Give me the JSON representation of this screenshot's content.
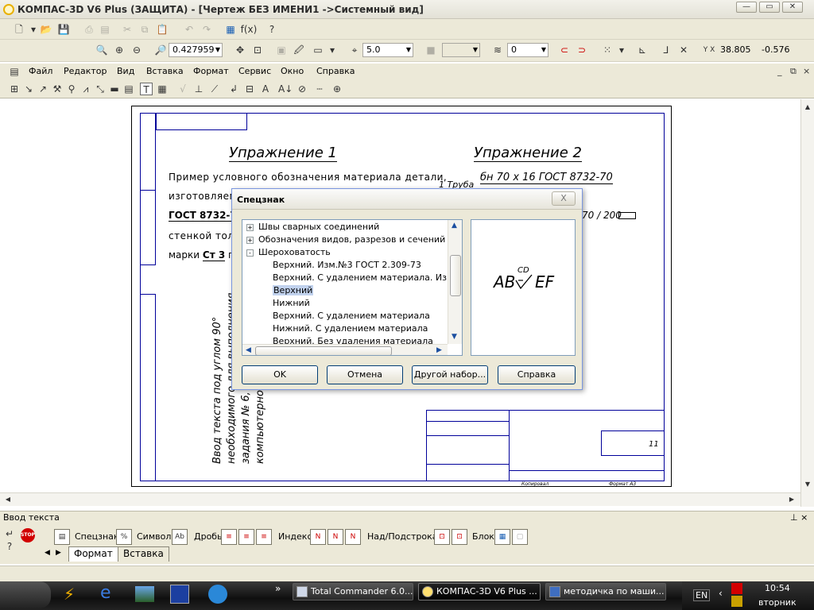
{
  "window": {
    "title": "КОМПАС-3D V6 Plus (ЗАЩИТА) - [Чертеж БЕЗ ИМЕНИ1 ->Системный вид]"
  },
  "toolbar_top": {
    "zoom_value": "0.427959",
    "step_value": "5.0",
    "layer_value": "0",
    "coord_x": "38.805",
    "coord_y": "-0.576",
    "fx_label": "f(x)"
  },
  "menu": {
    "items": [
      "Файл",
      "Редактор",
      "Вид",
      "Вставка",
      "Формат",
      "Сервис",
      "Окно",
      "Справка"
    ]
  },
  "drawing": {
    "title1": "Упражнение 1",
    "title2": "Упражнение 2",
    "ex1_line1": "Пример условного обозначения материала детали,",
    "ex1_line2": "изготовляемой",
    "ex1_line3": "ГОСТ 8732-7",
    "ex1_line4": "стенкой толщ",
    "ex1_line5_a": "марки",
    "ex1_line5_b": "Ст 3",
    "ex1_line5_c": "по",
    "ex2_prefix": "1 Труба",
    "ex2_value": "бн 70 х 16 ГОСТ 8732-70",
    "ex2_frac": "70 / 200",
    "vertical_text_1": "Ввод текста под углом 90°",
    "vertical_text_2": "необходимого для выполнения",
    "vertical_text_3": "задания № 6, ра",
    "vertical_text_4": "компьютерной г",
    "stamp_sheet": "11",
    "stamp_format": "Формат А3",
    "stamp_copied": "Копировал"
  },
  "dialog": {
    "title": "Спецзнак",
    "close_label": "X",
    "tree": [
      {
        "label": "Швы сварных соединений",
        "level": 0,
        "expander": "+"
      },
      {
        "label": "Обозначения видов, разрезов и сечений",
        "level": 0,
        "expander": "+"
      },
      {
        "label": "Шероховатость",
        "level": 0,
        "expander": "-"
      },
      {
        "label": "Верхний. Изм.№3 ГОСТ 2.309-73",
        "level": 1,
        "expander": ""
      },
      {
        "label": "Верхний. С удалением материала. Изм.№3",
        "level": 1,
        "expander": ""
      },
      {
        "label": "Верхний",
        "level": 1,
        "expander": "",
        "selected": true
      },
      {
        "label": "Нижний",
        "level": 1,
        "expander": ""
      },
      {
        "label": "Верхний. С удалением материала",
        "level": 1,
        "expander": ""
      },
      {
        "label": "Нижний. С удалением материала",
        "level": 1,
        "expander": ""
      },
      {
        "label": "Верхний. Без удаления материала",
        "level": 1,
        "expander": ""
      }
    ],
    "preview_left": "AB",
    "preview_top": "CD",
    "preview_right": "EF",
    "buttons": {
      "ok": "OK",
      "cancel": "Отмена",
      "other": "Другой набор...",
      "help": "Справка"
    }
  },
  "panel": {
    "title": "Ввод текста",
    "pin": "⊥ ×",
    "labels": [
      "Спецзнак",
      "Символ",
      "Дробь",
      "Индекс",
      "Над/Подстрока",
      "Блок"
    ],
    "tabs": [
      "Формат",
      "Вставка"
    ],
    "stop": "STOP"
  },
  "taskbar": {
    "items": [
      {
        "label": "Total Commander 6.0..."
      },
      {
        "label": "КОМПАС-3D V6 Plus ..."
      },
      {
        "label": "методичка по маши..."
      }
    ],
    "lang": "EN",
    "time": "10:54",
    "day": "вторник",
    "chevron": "»"
  },
  "colors": {
    "frame_blue": "#00009a",
    "selection": "#c1d2ee"
  }
}
